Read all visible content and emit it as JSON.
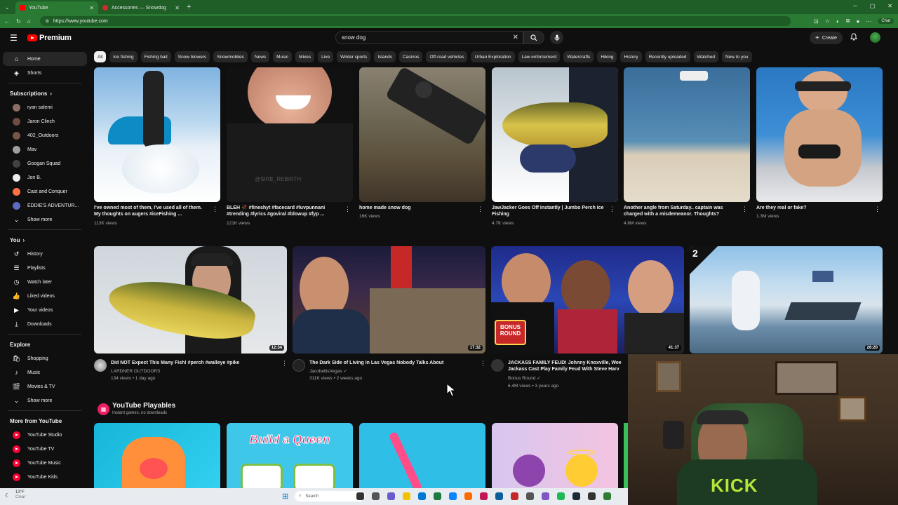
{
  "browser": {
    "tabs": [
      {
        "label": "YouTube",
        "active": true
      },
      {
        "label": "Accessories — Snowdog",
        "active": false
      }
    ],
    "url": "https://www.youtube.com",
    "chat_label": "Chat"
  },
  "header": {
    "logo_text": "Premium",
    "search_value": "snow dog",
    "create_label": "Create"
  },
  "sidebar": {
    "main": [
      {
        "label": "Home",
        "icon": "home-icon"
      },
      {
        "label": "Shorts",
        "icon": "shorts-icon"
      }
    ],
    "subscriptions_label": "Subscriptions",
    "subscriptions": [
      {
        "label": "ryan salemi",
        "color": "#8d6e63"
      },
      {
        "label": "Jaron Clinch",
        "color": "#6d4c41"
      },
      {
        "label": "402_Outdoors",
        "color": "#795548"
      },
      {
        "label": "Mav",
        "color": "#9e9e9e"
      },
      {
        "label": "Googan Squad",
        "color": "#424242"
      },
      {
        "label": "Jon B.",
        "color": "#eeeeee"
      },
      {
        "label": "Cast and Conquer",
        "color": "#ff7043"
      },
      {
        "label": "EDDIE'S ADVENTUR...",
        "color": "#5c6bc0"
      }
    ],
    "show_more_1": "Show more",
    "you_label": "You",
    "you": [
      {
        "label": "History",
        "icon": "history-icon"
      },
      {
        "label": "Playlists",
        "icon": "playlists-icon"
      },
      {
        "label": "Watch later",
        "icon": "watch-later-icon"
      },
      {
        "label": "Liked videos",
        "icon": "like-icon"
      },
      {
        "label": "Your videos",
        "icon": "your-videos-icon"
      },
      {
        "label": "Downloads",
        "icon": "download-icon"
      }
    ],
    "explore_label": "Explore",
    "explore": [
      {
        "label": "Shopping",
        "icon": "shopping-icon"
      },
      {
        "label": "Music",
        "icon": "music-icon"
      },
      {
        "label": "Movies & TV",
        "icon": "movies-icon"
      }
    ],
    "show_more_2": "Show more",
    "more_label": "More from YouTube",
    "more": [
      {
        "label": "YouTube Studio"
      },
      {
        "label": "YouTube TV"
      },
      {
        "label": "YouTube Music"
      },
      {
        "label": "YouTube Kids"
      }
    ]
  },
  "chips": [
    "All",
    "Ice fishing",
    "Fishing bait",
    "Snow blowers",
    "Snowmobiles",
    "News",
    "Music",
    "Mixes",
    "Live",
    "Winter sports",
    "Islands",
    "Casinos",
    "Off-road vehicles",
    "Urban Exploration",
    "Law enforcement",
    "Watercrafts",
    "Hiking",
    "History",
    "Recently uploaded",
    "Watched",
    "New to you"
  ],
  "shorts": [
    {
      "title": "I've owned most of them, I've used all of them. My thoughts on augers #iceFishing ...",
      "views": "113K views"
    },
    {
      "title": "BLEH 🥀 #fineshyt #facecard #luvpunnani #trending #lyrics #goviral #blowup #fyp ...",
      "views": "121K views"
    },
    {
      "title": "home made snow dog",
      "views": "16K views"
    },
    {
      "title": "JawJacker Goes Off Instantly | Jumbo Perch Ice Fishing",
      "views": "4.7K views"
    },
    {
      "title": "Another angle from Saturday.. captain was charged with a misdemeanor.  Thoughts?",
      "views": "4.8M views"
    },
    {
      "title": "Are they real or fake?",
      "views": "1.3M views"
    }
  ],
  "videos": [
    {
      "title": "Did NOT Expect This Many Fish! #perch #walleye #pike",
      "channel": "LARDNER OUTDOORS",
      "meta": "134 views • 1 day ago",
      "duration": "12:34"
    },
    {
      "title": "The Dark Side of Living in Las Vegas Nobody Talks About",
      "channel": "JacobellisVegas",
      "meta": "311K views • 2 weeks ago",
      "duration": "17:32"
    },
    {
      "title": "JACKASS FAMILY FEUD! Johnny Knoxville, Wee Jackass Cast Play Family Feud With Steve Harv",
      "channel": "Bonus Round",
      "meta": "6.4M views • 3 years ago",
      "duration": "41:37"
    },
    {
      "title": "",
      "channel": "",
      "meta": "",
      "duration": "26:20"
    }
  ],
  "playables": {
    "title": "YouTube Playables",
    "subtitle": "Instant games, no downloads",
    "game2_text": "Build a Queen"
  },
  "thumb_texts": {
    "bonus_round": "BONUS ROUND",
    "number_badge": "2",
    "watermark": "@SIRE_REBIRTH"
  },
  "webcam": {
    "shirt_text": "KICK"
  },
  "taskbar": {
    "weather_temp": "13°F",
    "weather_desc": "Clear",
    "search_placeholder": "Search"
  }
}
